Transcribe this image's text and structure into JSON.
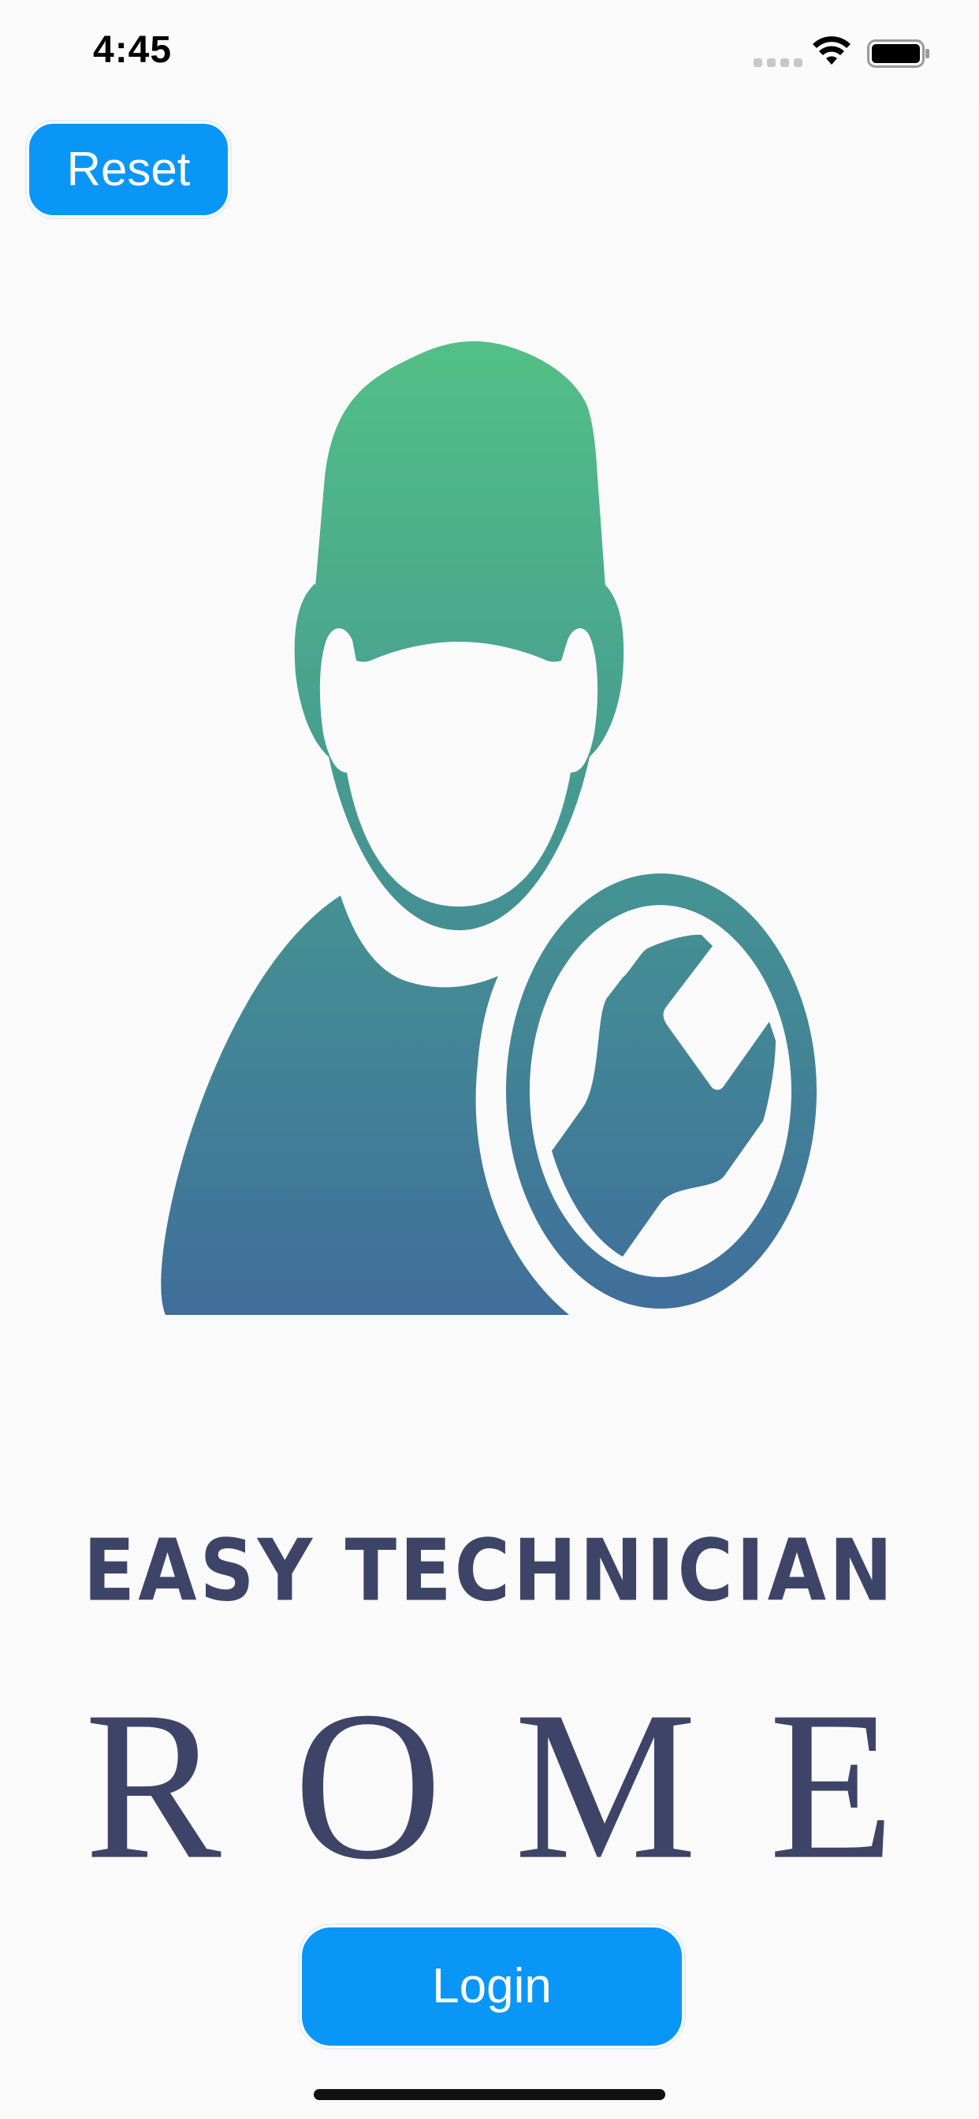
{
  "status_bar": {
    "time": "4:45"
  },
  "buttons": {
    "reset_label": "Reset",
    "login_label": "Login"
  },
  "logo": {
    "icon": "technician-wrench-icon",
    "gradient_top": "#52bf86",
    "gradient_bottom": "#3f6d9b"
  },
  "brand": {
    "title": "EASY TECHNICIAN",
    "city": "ROME"
  },
  "colors": {
    "accent_button": "#0a96f7",
    "text_navy": "#3d4468",
    "background": "#fafafa"
  }
}
